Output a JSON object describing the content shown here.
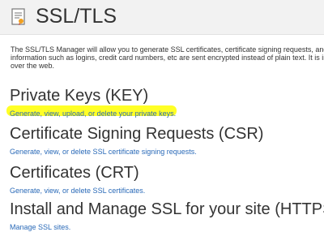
{
  "header": {
    "title": "SSL/TLS",
    "icon": "certificate-document-icon"
  },
  "description": {
    "line1": "The SSL/TLS Manager will allow you to generate SSL certificates, certificate signing requests, and private",
    "line2": "information such as logins, credit card numbers, etc are sent encrypted instead of plain text. It is impor",
    "line3": "over the web."
  },
  "sections": [
    {
      "heading": "Private Keys (KEY)",
      "link": "Generate, view, upload, or delete your private keys."
    },
    {
      "heading": "Certificate Signing Requests (CSR)",
      "link": "Generate, view, or delete SSL certificate signing requests."
    },
    {
      "heading": "Certificates (CRT)",
      "link": "Generate, view, or delete SSL certificates."
    },
    {
      "heading": "Install and Manage SSL for your site (HTTPS)",
      "link": "Manage SSL sites."
    }
  ],
  "colors": {
    "link": "#2a6ab8",
    "highlight": "#ffff00",
    "header_bg": "#f2f2f2"
  }
}
